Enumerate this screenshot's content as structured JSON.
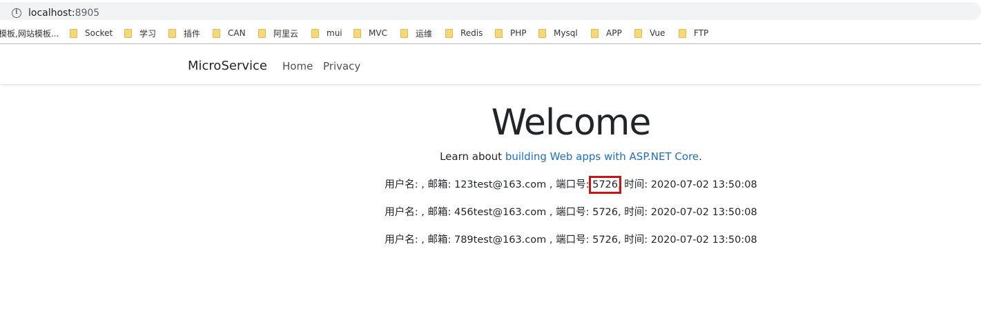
{
  "address_bar": {
    "url_host": "localhost:",
    "url_port": "8905"
  },
  "bookmarks": [
    {
      "label": "模板,网站模板..."
    },
    {
      "label": "Socket"
    },
    {
      "label": "学习"
    },
    {
      "label": "插件"
    },
    {
      "label": "CAN"
    },
    {
      "label": "阿里云"
    },
    {
      "label": "mui"
    },
    {
      "label": "MVC"
    },
    {
      "label": "运维"
    },
    {
      "label": "Redis"
    },
    {
      "label": "PHP"
    },
    {
      "label": "Mysql"
    },
    {
      "label": "APP"
    },
    {
      "label": "Vue"
    },
    {
      "label": "FTP"
    }
  ],
  "navbar": {
    "brand": "MicroService",
    "links": [
      "Home",
      "Privacy"
    ]
  },
  "main": {
    "title": "Welcome",
    "learn_prefix": "Learn about ",
    "learn_link": "building Web apps with ASP.NET Core",
    "learn_suffix": ".",
    "users": [
      {
        "prefix": "用户名: , 邮箱: ",
        "email": "123test@163.com",
        "port_label": " , 端口号: ",
        "port": "5726",
        "time_label": ", 时间: ",
        "time": "2020-07-02 13:50:08",
        "highlight_port": true
      },
      {
        "prefix": "用户名: , 邮箱: ",
        "email": "456test@163.com",
        "port_label": " , 端口号: ",
        "port": "5726",
        "time_label": ", 时间: ",
        "time": "2020-07-02 13:50:08",
        "highlight_port": false
      },
      {
        "prefix": "用户名: , 邮箱: ",
        "email": "789test@163.com",
        "port_label": " , 端口号: ",
        "port": "5726",
        "time_label": ", 时间: ",
        "time": "2020-07-02 13:50:08",
        "highlight_port": false
      }
    ]
  },
  "colors": {
    "link": "#1b6ec2",
    "highlight_box": "#cc1111",
    "folder": "#f6d779"
  }
}
